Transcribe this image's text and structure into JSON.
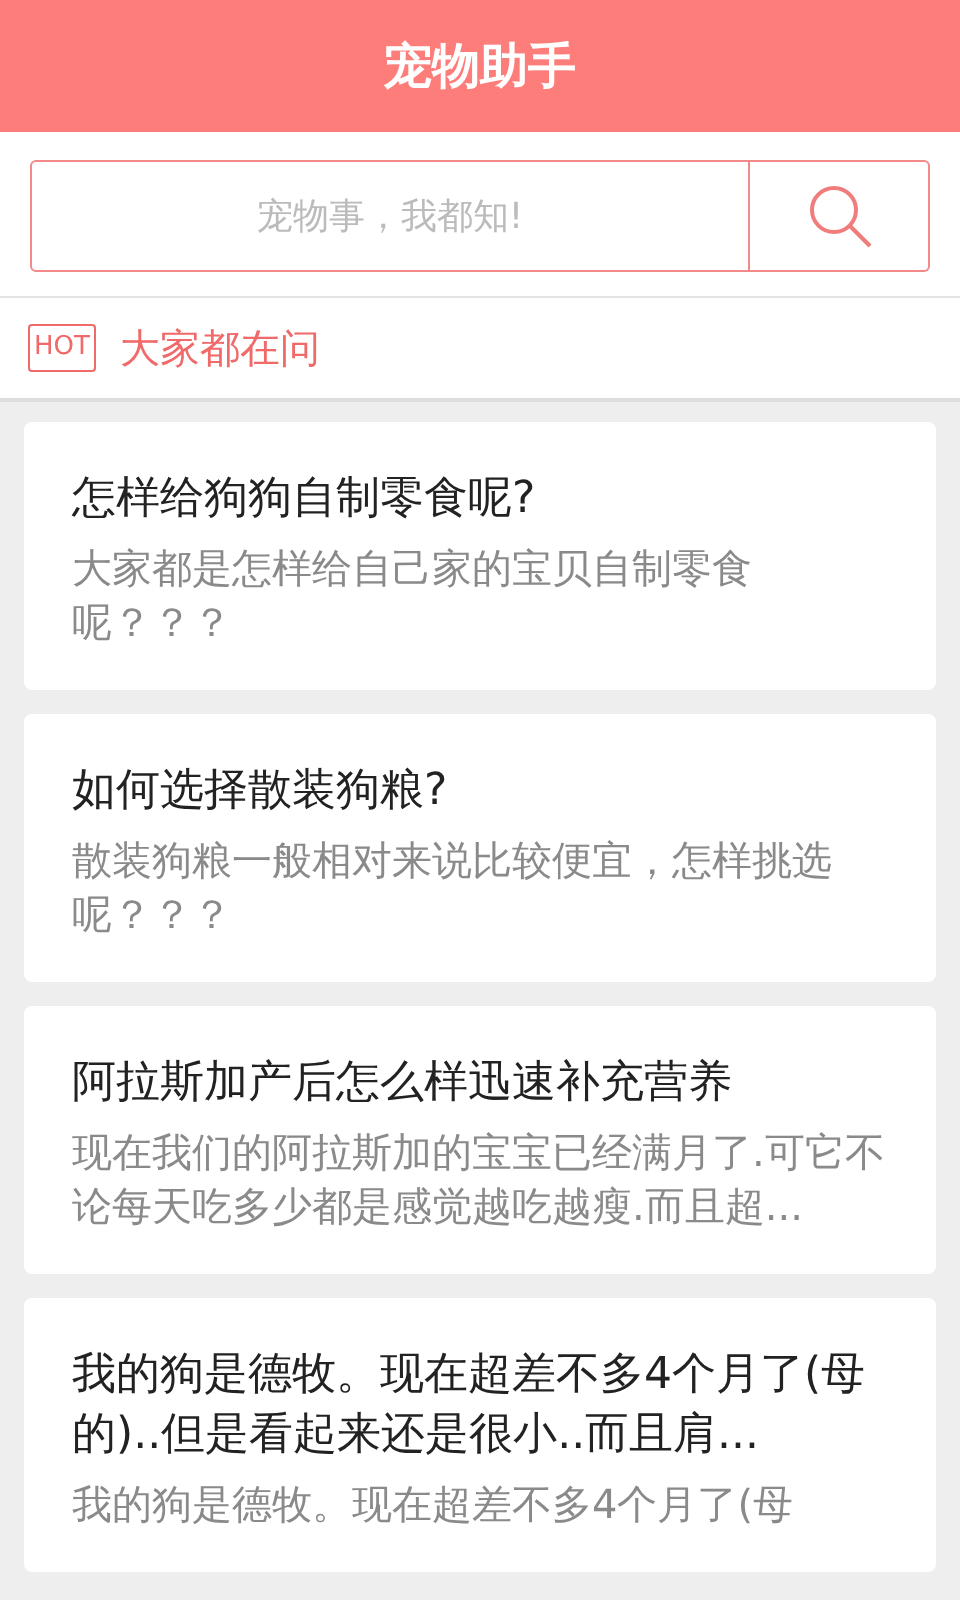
{
  "header": {
    "title": "宠物助手"
  },
  "search": {
    "placeholder": "宠物事，我都知!"
  },
  "hot": {
    "badge": "HOT",
    "label": "大家都在问"
  },
  "questions": [
    {
      "title": "怎样给狗狗自制零食呢?",
      "summary": "大家都是怎样给自己家的宝贝自制零食呢？？？"
    },
    {
      "title": "如何选择散装狗粮?",
      "summary": "散装狗粮一般相对来说比较便宜，怎样挑选呢？？？"
    },
    {
      "title": "阿拉斯加产后怎么样迅速补充营养",
      "summary": "现在我们的阿拉斯加的宝宝已经满月了.可它不论每天吃多少都是感觉越吃越瘦.而且超..."
    },
    {
      "title": "我的狗是德牧。现在超差不多4个月了(母的)..但是看起来还是很小..而且肩...",
      "summary": "我的狗是德牧。现在超差不多4个月了(母"
    }
  ]
}
